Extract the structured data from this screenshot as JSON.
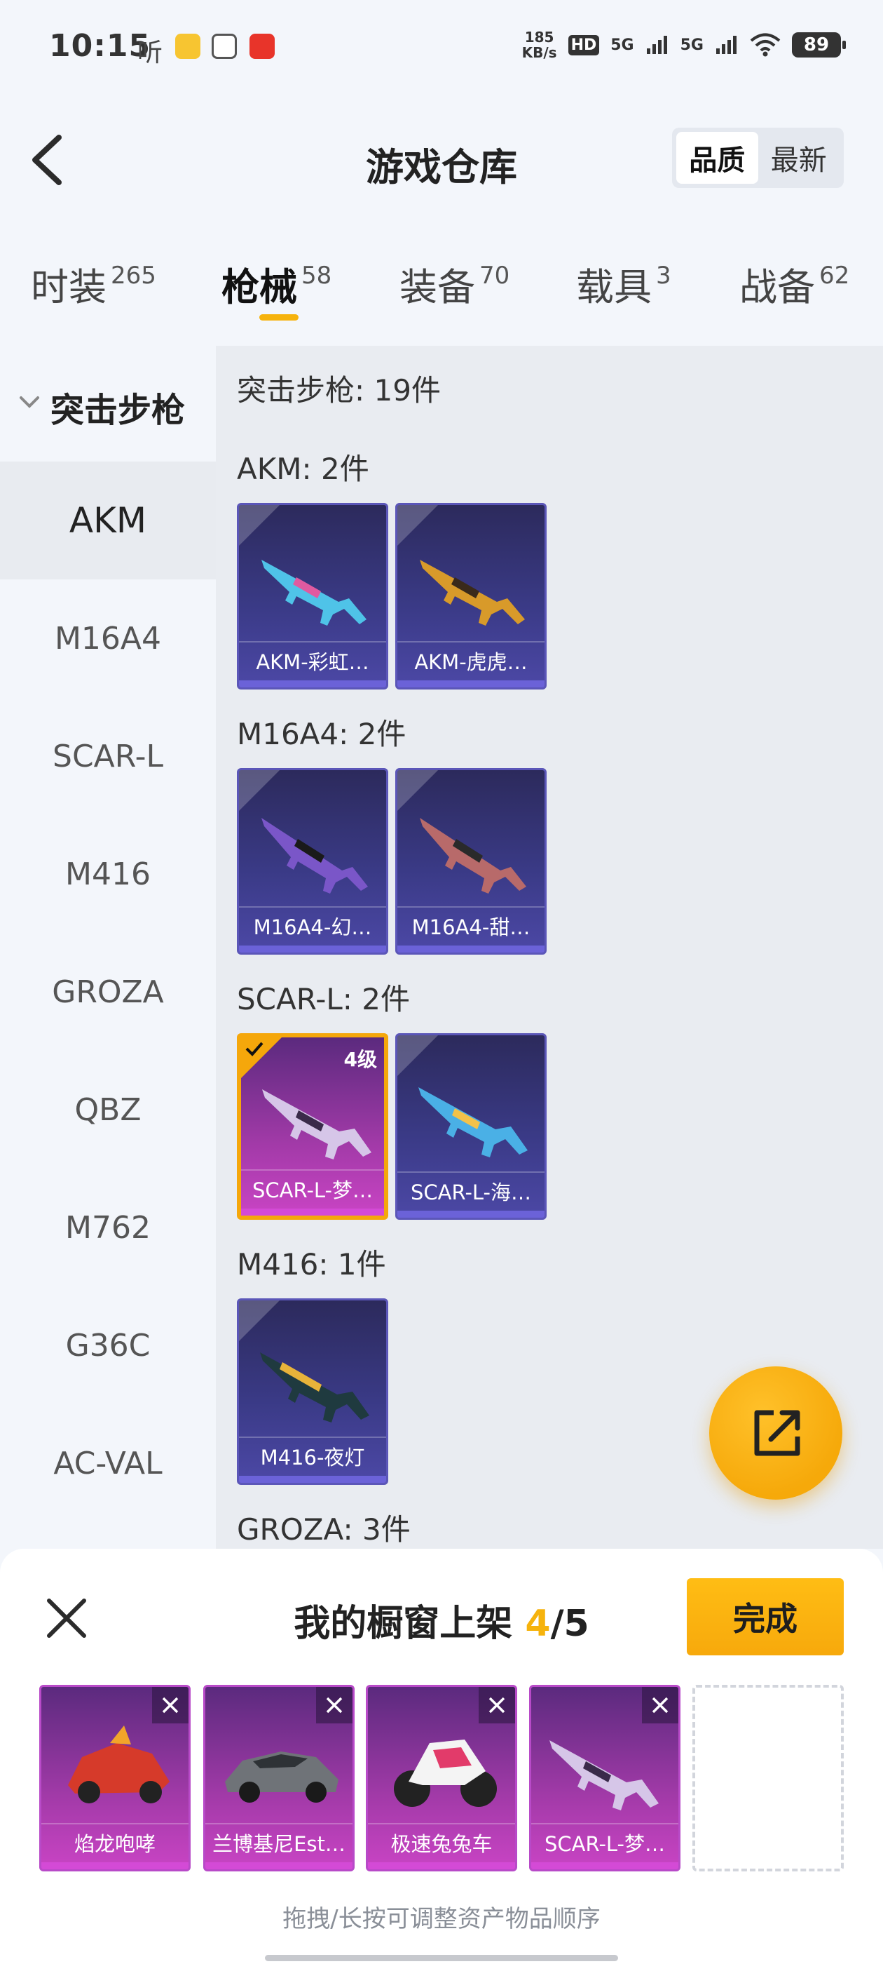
{
  "status_bar": {
    "time": "10:15",
    "app_ting": "听",
    "speed_value": "185",
    "speed_unit": "KB/s",
    "hd": "HD",
    "net1": "5G",
    "net2": "5G",
    "battery": "89"
  },
  "header": {
    "title": "游戏仓库",
    "sort_options": [
      "品质",
      "最新"
    ],
    "active_sort": "品质"
  },
  "tabs": [
    {
      "label": "时装",
      "count": "265"
    },
    {
      "label": "枪械",
      "count": "58"
    },
    {
      "label": "装备",
      "count": "70"
    },
    {
      "label": "载具",
      "count": "3"
    },
    {
      "label": "战备",
      "count": "62"
    }
  ],
  "active_tab": "枪械",
  "sidebar": {
    "category": "突击步枪",
    "items": [
      "AKM",
      "M16A4",
      "SCAR-L",
      "M416",
      "GROZA",
      "QBZ",
      "M762",
      "G36C",
      "AC-VAL"
    ],
    "active": "AKM"
  },
  "main": {
    "summary": "突击步枪: 19件",
    "groups": [
      {
        "label": "AKM: 2件",
        "items": [
          "AKM-彩虹…",
          "AKM-虎虎…"
        ]
      },
      {
        "label": "M16A4: 2件",
        "items": [
          "M16A4-幻…",
          "M16A4-甜…"
        ]
      },
      {
        "label": "SCAR-L: 2件",
        "items": [
          "SCAR-L-梦…",
          "SCAR-L-海…"
        ],
        "selected_level": "4级"
      },
      {
        "label": "M416: 1件",
        "items": [
          "M416-夜灯"
        ]
      },
      {
        "label": "GROZA: 3件",
        "items": []
      }
    ]
  },
  "sheet": {
    "title_prefix": "我的橱窗上架",
    "current": "4",
    "total": "/5",
    "done_label": "完成",
    "slots": [
      "焰龙咆哮",
      "兰博基尼Est…",
      "极速兔兔车",
      "SCAR-L-梦…"
    ],
    "hint": "拖拽/长按可调整资产物品顺序"
  },
  "colors": {
    "accent": "#f6b30d",
    "card_blue": "#3a3a86",
    "card_pink": "#a23aa8"
  }
}
